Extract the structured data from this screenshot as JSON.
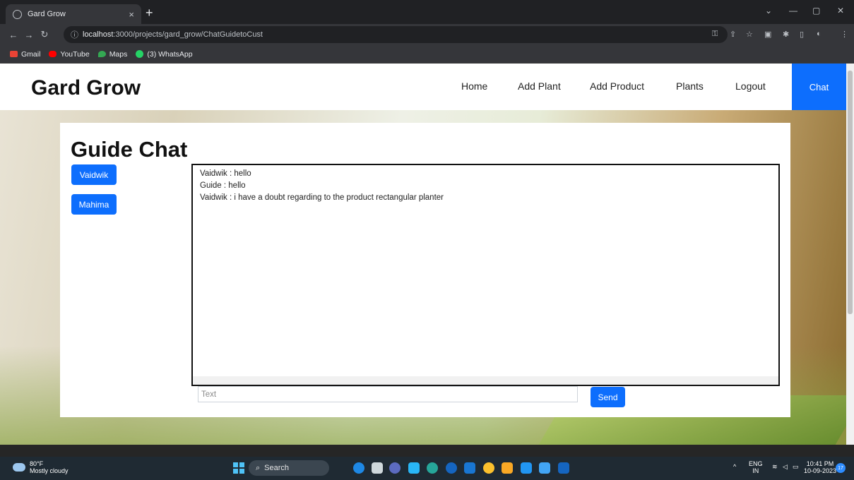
{
  "browser": {
    "tab_title": "Gard Grow",
    "tab_close": "×",
    "new_tab": "+",
    "url_host": "localhost",
    "url_rest": ":3000/projects/gard_grow/ChatGuidetoCust",
    "bookmarks": [
      "Gmail",
      "YouTube",
      "Maps",
      "(3) WhatsApp"
    ]
  },
  "site": {
    "brand": "Gard Grow",
    "nav": [
      "Home",
      "Add Plant",
      "Add Product",
      "Plants",
      "Logout"
    ],
    "chat_nav": "Chat"
  },
  "main": {
    "title": "Guide Chat",
    "users": [
      "Vaidwik",
      "Mahima"
    ],
    "messages": [
      "Vaidwik : hello",
      "Guide : hello",
      "Vaidwik : i have a doubt regarding to the product rectangular planter"
    ],
    "input_placeholder": "Text",
    "send_label": "Send"
  },
  "taskbar": {
    "temperature": "80°F",
    "weather": "Mostly cloudy",
    "search": "Search",
    "lang": "ENG",
    "region": "IN",
    "time": "10:41 PM",
    "date": "10-09-2023",
    "notifications": "17"
  }
}
